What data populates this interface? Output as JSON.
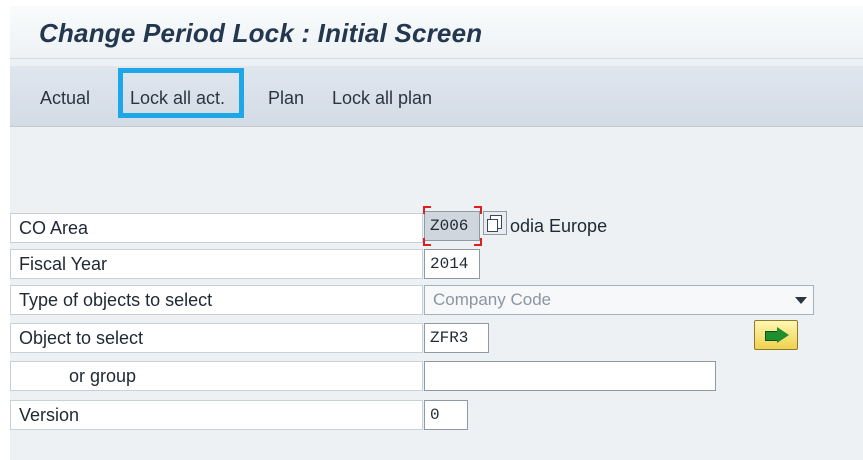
{
  "window": {
    "title": "Change Period Lock : Initial Screen"
  },
  "toolbar": {
    "items": [
      {
        "label": "Actual"
      },
      {
        "label": "Lock all act."
      },
      {
        "label": "Plan"
      },
      {
        "label": "Lock all plan"
      }
    ],
    "highlight_color": "#1ea7e8"
  },
  "form": {
    "co_area": {
      "label": "CO Area",
      "value": "Z006",
      "description": "odia Europe"
    },
    "fiscal_year": {
      "label": "Fiscal Year",
      "value": "2014"
    },
    "type_objects": {
      "label": "Type of objects to select",
      "value": "Company Code"
    },
    "object": {
      "label": "Object to select",
      "value": "ZFR3"
    },
    "group": {
      "label": "or group",
      "value": ""
    },
    "version": {
      "label": "Version",
      "value": "0"
    }
  },
  "icons": {
    "copy": "copy-icon",
    "dropdown": "dropdown-arrow-icon",
    "execute": "execute-arrow-icon"
  }
}
